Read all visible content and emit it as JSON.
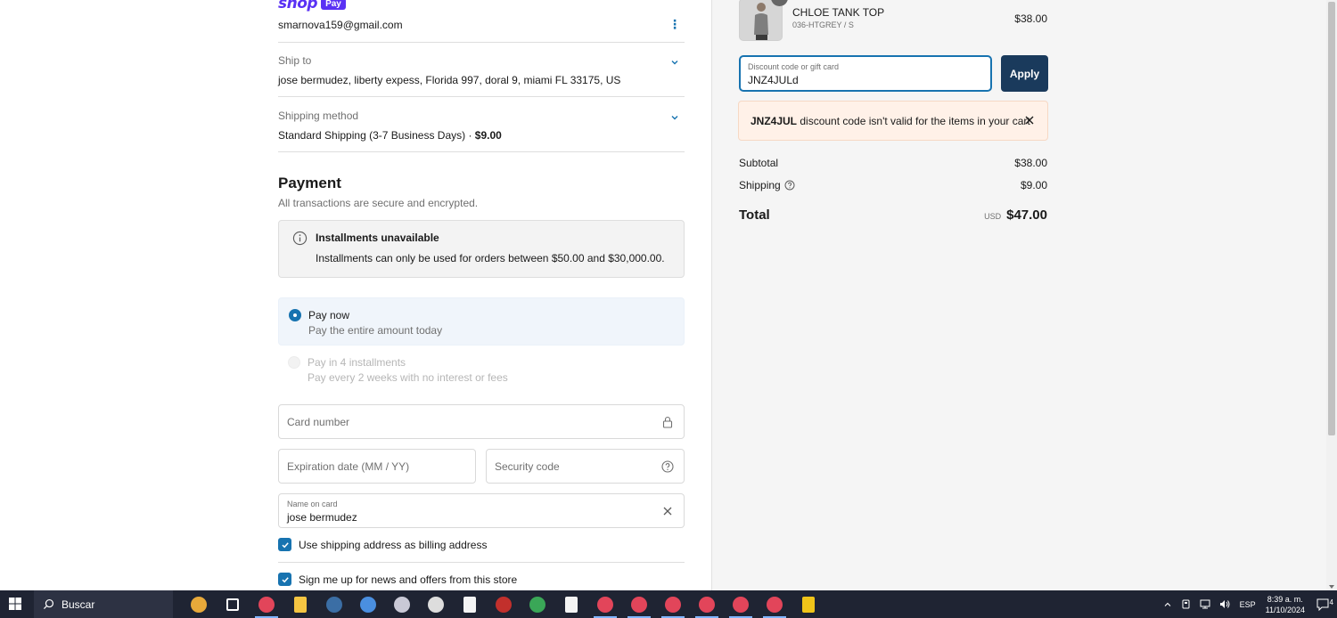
{
  "shop_pay": {
    "word": "shop",
    "badge": "Pay"
  },
  "contact": {
    "email": "smarnova159@gmail.com",
    "menu_icon": "kebab-icon"
  },
  "ship_to": {
    "label": "Ship to",
    "value": "jose bermudez, liberty expess, Florida 997, doral 9, miami FL 33175, US"
  },
  "shipping_method": {
    "label": "Shipping method",
    "value": "Standard Shipping (3-7 Business Days)",
    "separator": " · ",
    "price": "$9.00"
  },
  "payment": {
    "title": "Payment",
    "subtitle": "All transactions are secure and encrypted.",
    "notice": {
      "title": "Installments unavailable",
      "body": "Installments can only be used for orders between $50.00 and $30,000.00."
    },
    "options": [
      {
        "title": "Pay now",
        "subtitle": "Pay the entire amount today",
        "selected": true
      },
      {
        "title": "Pay in 4 installments",
        "subtitle": "Pay every 2 weeks with no interest or fees",
        "selected": false
      }
    ],
    "card_number_placeholder": "Card number",
    "expiration_placeholder": "Expiration date (MM / YY)",
    "security_placeholder": "Security code",
    "name_label": "Name on card",
    "name_value": "jose bermudez",
    "billing_same_label": "Use shipping address as billing address",
    "newsletter_label": "Sign me up for news and offers from this store"
  },
  "order": {
    "product": {
      "name": "CHLOE TANK TOP",
      "variant": "036-HTGREY / S",
      "price": "$38.00",
      "quantity": "1"
    },
    "discount": {
      "label": "Discount code or gift card",
      "value": "JNZ4JULd",
      "apply": "Apply"
    },
    "error": {
      "code": "JNZ4JUL",
      "message": " discount code isn't valid for the items in your cart"
    },
    "subtotal_label": "Subtotal",
    "subtotal": "$38.00",
    "shipping_label": "Shipping",
    "shipping": "$9.00",
    "total_label": "Total",
    "currency": "USD",
    "total": "$47.00"
  },
  "taskbar": {
    "search_label": "Buscar",
    "language": "ESP",
    "time": "8:39 a. m.",
    "date": "11/10/2024",
    "notification_count": "4",
    "apps": [
      {
        "name": "widgets-icon",
        "color": "#e8a93a"
      },
      {
        "name": "task-view-icon",
        "color": "#ffffff"
      },
      {
        "name": "browser-profile-icon",
        "color": "#e2455a"
      },
      {
        "name": "file-explorer-icon",
        "color": "#f5c542"
      },
      {
        "name": "steam-icon",
        "color": "#3b6ea5"
      },
      {
        "name": "app-globe-icon",
        "color": "#4a8fe0"
      },
      {
        "name": "app-circle-icon",
        "color": "#c9c9d6"
      },
      {
        "name": "app-a-icon",
        "color": "#dddddd"
      },
      {
        "name": "document-icon",
        "color": "#f4f4f4"
      },
      {
        "name": "app-red-icon",
        "color": "#c2302c"
      },
      {
        "name": "chrome-icon",
        "color": "#3aa757"
      },
      {
        "name": "document-icon-2",
        "color": "#f4f4f4"
      },
      {
        "name": "browser-profile-icon-2",
        "color": "#e2455a"
      },
      {
        "name": "browser-profile-icon-3",
        "color": "#e2455a"
      },
      {
        "name": "browser-profile-icon-4",
        "color": "#e2455a"
      },
      {
        "name": "browser-profile-icon-5",
        "color": "#e2455a"
      },
      {
        "name": "browser-profile-icon-6",
        "color": "#e2455a"
      },
      {
        "name": "browser-profile-icon-7",
        "color": "#e2455a"
      },
      {
        "name": "sticky-notes-icon",
        "color": "#f0c419"
      }
    ]
  }
}
